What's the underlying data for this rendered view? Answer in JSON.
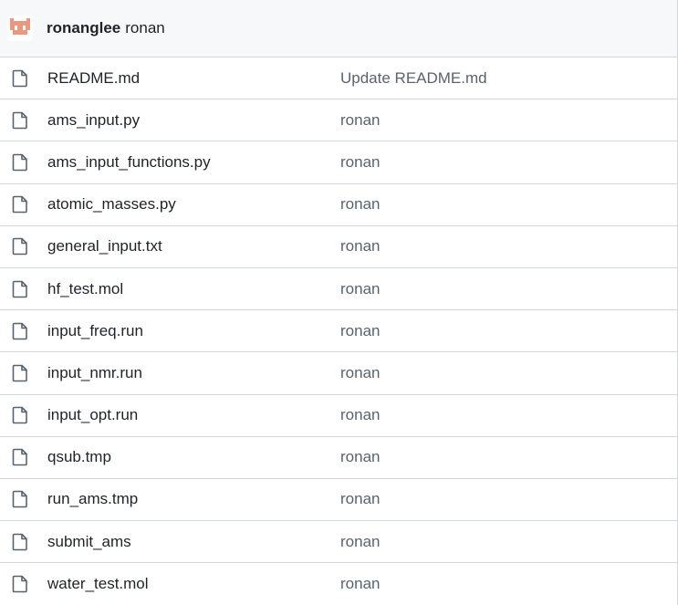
{
  "header": {
    "author": "ronanglee",
    "commit_message": "ronan"
  },
  "colors": {
    "avatar": "#e8997f",
    "border": "#d0d7de",
    "header_bg": "#f6f8fa",
    "muted_text": "#59636e"
  },
  "files": [
    {
      "name": "README.md",
      "message": "Update README.md",
      "icon": "file-icon"
    },
    {
      "name": "ams_input.py",
      "message": "ronan",
      "icon": "file-icon"
    },
    {
      "name": "ams_input_functions.py",
      "message": "ronan",
      "icon": "file-icon"
    },
    {
      "name": "atomic_masses.py",
      "message": "ronan",
      "icon": "file-icon"
    },
    {
      "name": "general_input.txt",
      "message": "ronan",
      "icon": "file-icon"
    },
    {
      "name": "hf_test.mol",
      "message": "ronan",
      "icon": "file-icon"
    },
    {
      "name": "input_freq.run",
      "message": "ronan",
      "icon": "file-icon"
    },
    {
      "name": "input_nmr.run",
      "message": "ronan",
      "icon": "file-icon"
    },
    {
      "name": "input_opt.run",
      "message": "ronan",
      "icon": "file-icon"
    },
    {
      "name": "qsub.tmp",
      "message": "ronan",
      "icon": "file-icon"
    },
    {
      "name": "run_ams.tmp",
      "message": "ronan",
      "icon": "file-icon"
    },
    {
      "name": "submit_ams",
      "message": "ronan",
      "icon": "file-icon"
    },
    {
      "name": "water_test.mol",
      "message": "ronan",
      "icon": "file-icon"
    }
  ]
}
